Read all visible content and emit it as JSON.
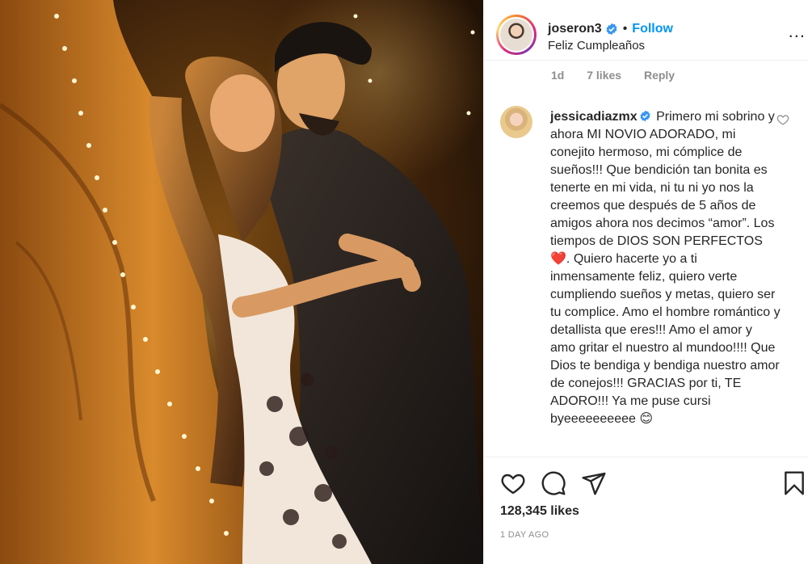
{
  "post": {
    "username": "joseron3",
    "follow_label": "Follow",
    "separator": "•",
    "subtitle": "Feliz Cumpleaños",
    "more_label": "..."
  },
  "previous_comment_meta": {
    "time": "1d",
    "likes": "7 likes",
    "reply": "Reply"
  },
  "comment": {
    "username": "jessicadiazmx",
    "text": "Primero mi sobrino y ahora MI NOVIO ADORADO, mi conejito hermoso, mi cómplice de sueños!!! Que bendición tan bonita es tenerte en mi vida, ni tu ni yo nos la creemos que después de 5 años de amigos ahora nos decimos “amor”. Los tiempos de DIOS SON PERFECTOS❤️. Quiero hacerte yo a ti inmensamente feliz, quiero verte cumpliendo sueños y metas, quiero ser tu complice. Amo el hombre romántico y detallista que eres!!! Amo el amor y amo gritar el nuestro al mundoo!!!! Que Dios te bendiga y bendiga nuestro amor de conejos!!! GRACIAS por ti, TE ADORO!!! Ya me puse cursi byeeeeeeeeee 😊"
  },
  "actions": {
    "icons": [
      "heart-icon",
      "comment-icon",
      "share-icon",
      "bookmark-icon"
    ]
  },
  "stats": {
    "likes": "128,345 likes",
    "time_ago": "1 DAY AGO"
  },
  "colors": {
    "accent": "#0095f6",
    "text": "#262626",
    "muted": "#8e8e8e",
    "border": "#efefef"
  }
}
